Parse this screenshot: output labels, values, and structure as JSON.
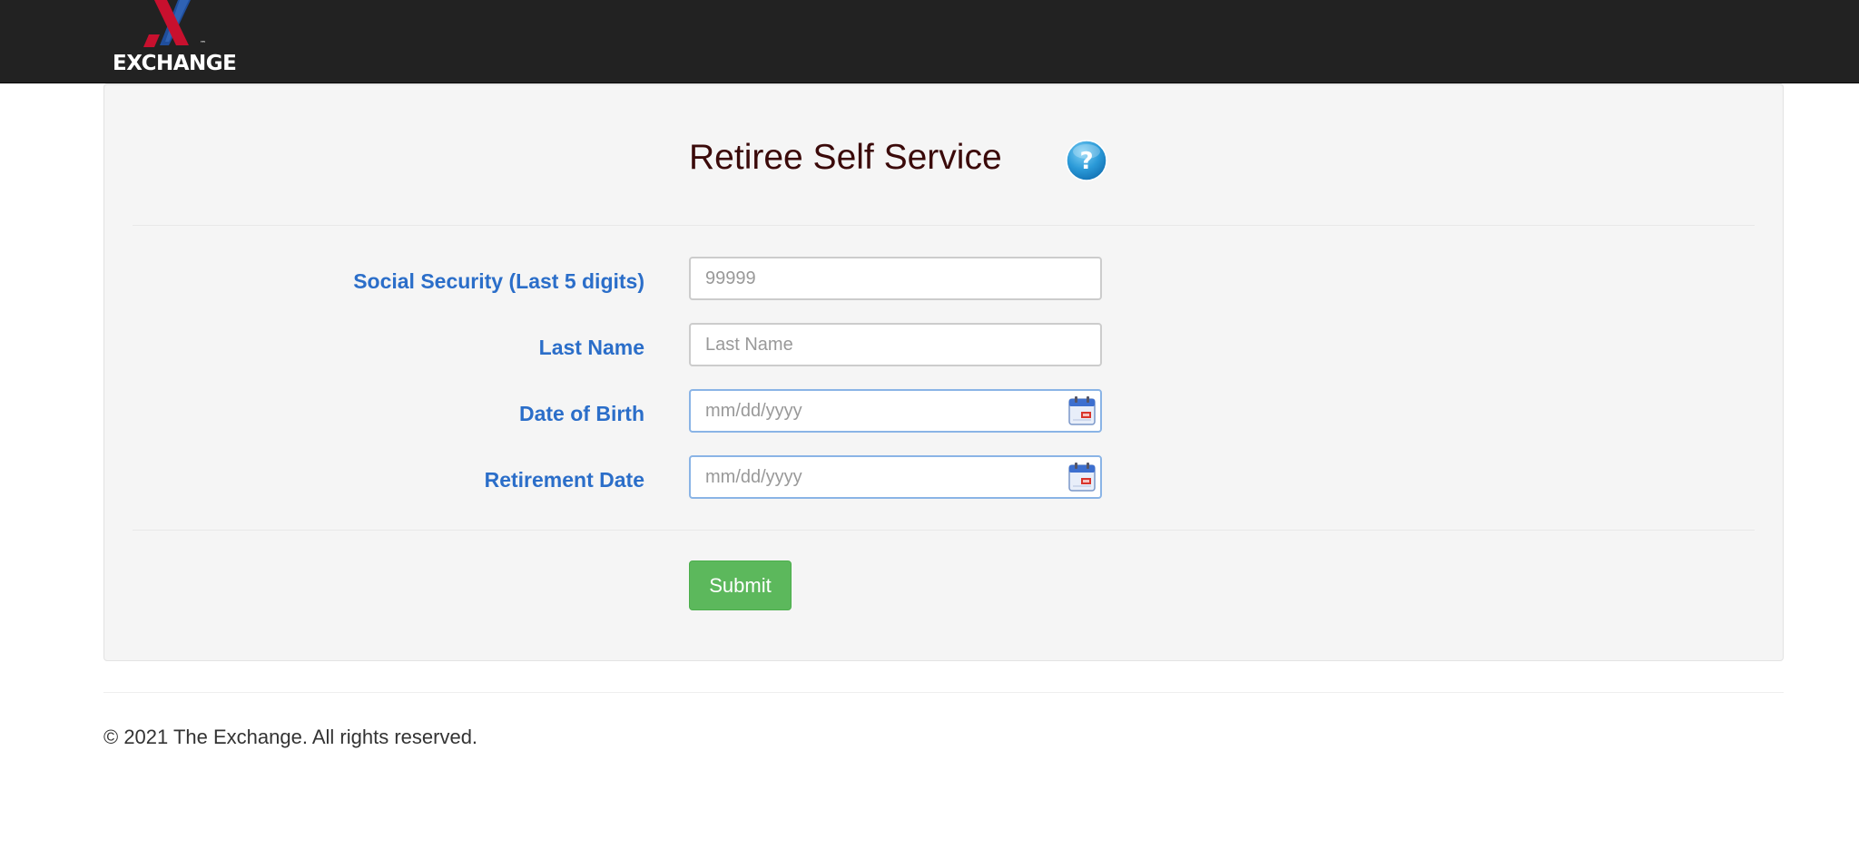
{
  "header": {
    "logo_text": "EXCHANGE",
    "logo_tm": "™",
    "background_color": "#222222"
  },
  "form": {
    "title": "Retiree Self Service",
    "help_icon": "question-circle-icon",
    "fields": [
      {
        "label": "Social Security (Last 5 digits)",
        "placeholder": "99999",
        "value": ""
      },
      {
        "label": "Last Name",
        "placeholder": "Last Name",
        "value": ""
      },
      {
        "label": "Date of Birth",
        "placeholder": "mm/dd/yyyy",
        "value": "",
        "icon": "calendar-icon"
      },
      {
        "label": "Retirement Date",
        "placeholder": "mm/dd/yyyy",
        "value": "",
        "icon": "calendar-icon"
      }
    ],
    "submit_label": "Submit"
  },
  "footer": {
    "copyright": "© 2021 The Exchange. All rights reserved."
  },
  "colors": {
    "label": "#2b6ec9",
    "title": "#3b0a0a",
    "submit": "#5cb85c",
    "logo_red": "#c8102e",
    "logo_blue": "#1f4e9c"
  }
}
